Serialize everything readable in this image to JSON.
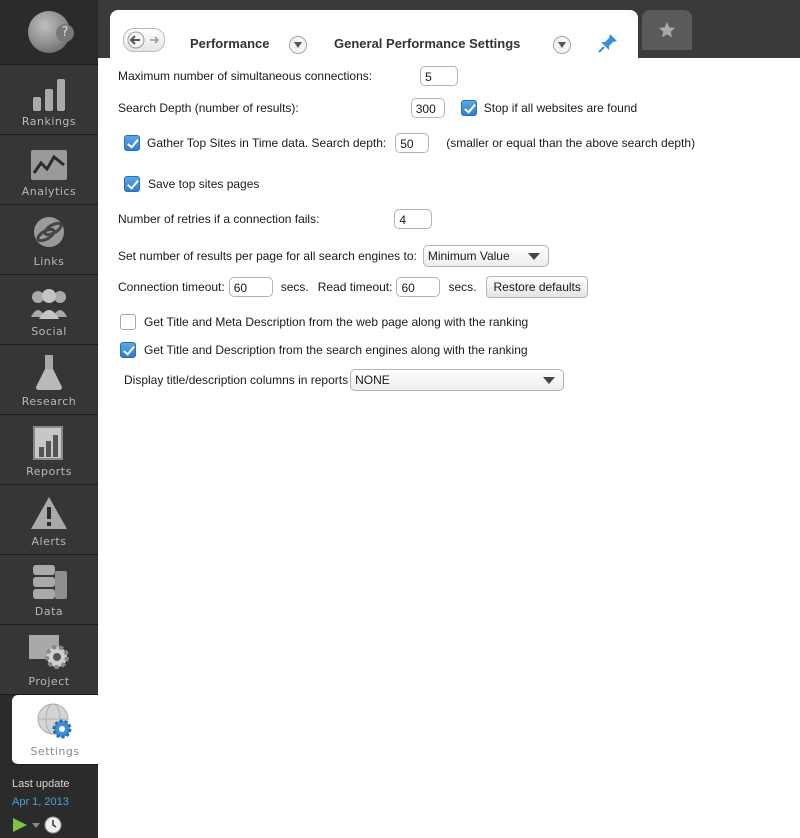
{
  "sidebar": {
    "help_glyph": "?",
    "items": [
      {
        "label": "Rankings",
        "icon": "bar-chart-icon"
      },
      {
        "label": "Analytics",
        "icon": "analytics-chart-icon"
      },
      {
        "label": "Links",
        "icon": "globe-link-icon"
      },
      {
        "label": "Social",
        "icon": "people-icon"
      },
      {
        "label": "Research",
        "icon": "flask-icon"
      },
      {
        "label": "Reports",
        "icon": "report-icon"
      },
      {
        "label": "Alerts",
        "icon": "warning-icon"
      },
      {
        "label": "Data",
        "icon": "database-icon"
      },
      {
        "label": "Project",
        "icon": "project-gear-icon"
      },
      {
        "label": "Settings",
        "icon": "settings-globe-icon",
        "active": true
      }
    ],
    "last_update_label": "Last update",
    "last_update_date": "Apr 1, 2013"
  },
  "header": {
    "crumb_section": "Performance",
    "crumb_page": "General Performance Settings"
  },
  "settings": {
    "max_connections_label": "Maximum number of simultaneous connections:",
    "max_connections_value": "5",
    "search_depth_label": "Search Depth (number of results):",
    "search_depth_value": "300",
    "stop_if_found_label": "Stop if all websites are found",
    "stop_if_found_checked": true,
    "gather_top_sites_label": "Gather Top Sites in Time data. Search depth:",
    "gather_top_sites_checked": true,
    "gather_depth_value": "50",
    "gather_depth_hint": "(smaller or equal than the above search depth)",
    "save_top_pages_label": "Save top sites pages",
    "save_top_pages_checked": true,
    "retries_label": "Number of retries if a connection fails:",
    "retries_value": "4",
    "results_per_page_label": "Set number of results per page for all search engines to:",
    "results_per_page_value": "Minimum Value",
    "connection_timeout_label": "Connection timeout:",
    "connection_timeout_value": "60",
    "secs_label_1": "secs.",
    "read_timeout_label": "Read timeout:",
    "read_timeout_value": "60",
    "secs_label_2": "secs.",
    "restore_defaults_label": "Restore defaults",
    "meta_from_page_label": "Get Title and Meta Description from the web page along with the ranking",
    "meta_from_page_checked": false,
    "desc_from_engines_label": "Get Title and Description from the search engines along with the ranking",
    "desc_from_engines_checked": true,
    "display_columns_label": "Display title/description columns in reports",
    "display_columns_value": "NONE"
  },
  "colors": {
    "sidebar_bg": "#2b2b2b",
    "accent_blue": "#2f7fcc",
    "date_blue": "#4ea1d3",
    "play_green": "#7cc243"
  }
}
